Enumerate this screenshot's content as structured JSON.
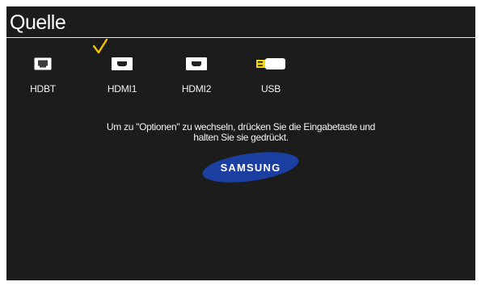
{
  "header": {
    "title": "Quelle"
  },
  "sources": [
    {
      "label": "HDBT",
      "icon": "hdbt-icon",
      "selected": false
    },
    {
      "label": "HDMI1",
      "icon": "hdmi-icon",
      "selected": true
    },
    {
      "label": "HDMI2",
      "icon": "hdmi-icon",
      "selected": false
    },
    {
      "label": "USB",
      "icon": "usb-icon",
      "selected": false
    }
  ],
  "message": {
    "line1": "Um zu \"Optionen\" zu wechseln, drücken Sie die Eingabetaste und",
    "line2": "halten Sie sie gedrückt."
  },
  "logo": {
    "text": "SAMSUNG"
  },
  "colors": {
    "background": "#1c1c1c",
    "selection_check": "#f2c500",
    "logo_blue": "#1b3fa0",
    "text": "#ffffff"
  }
}
